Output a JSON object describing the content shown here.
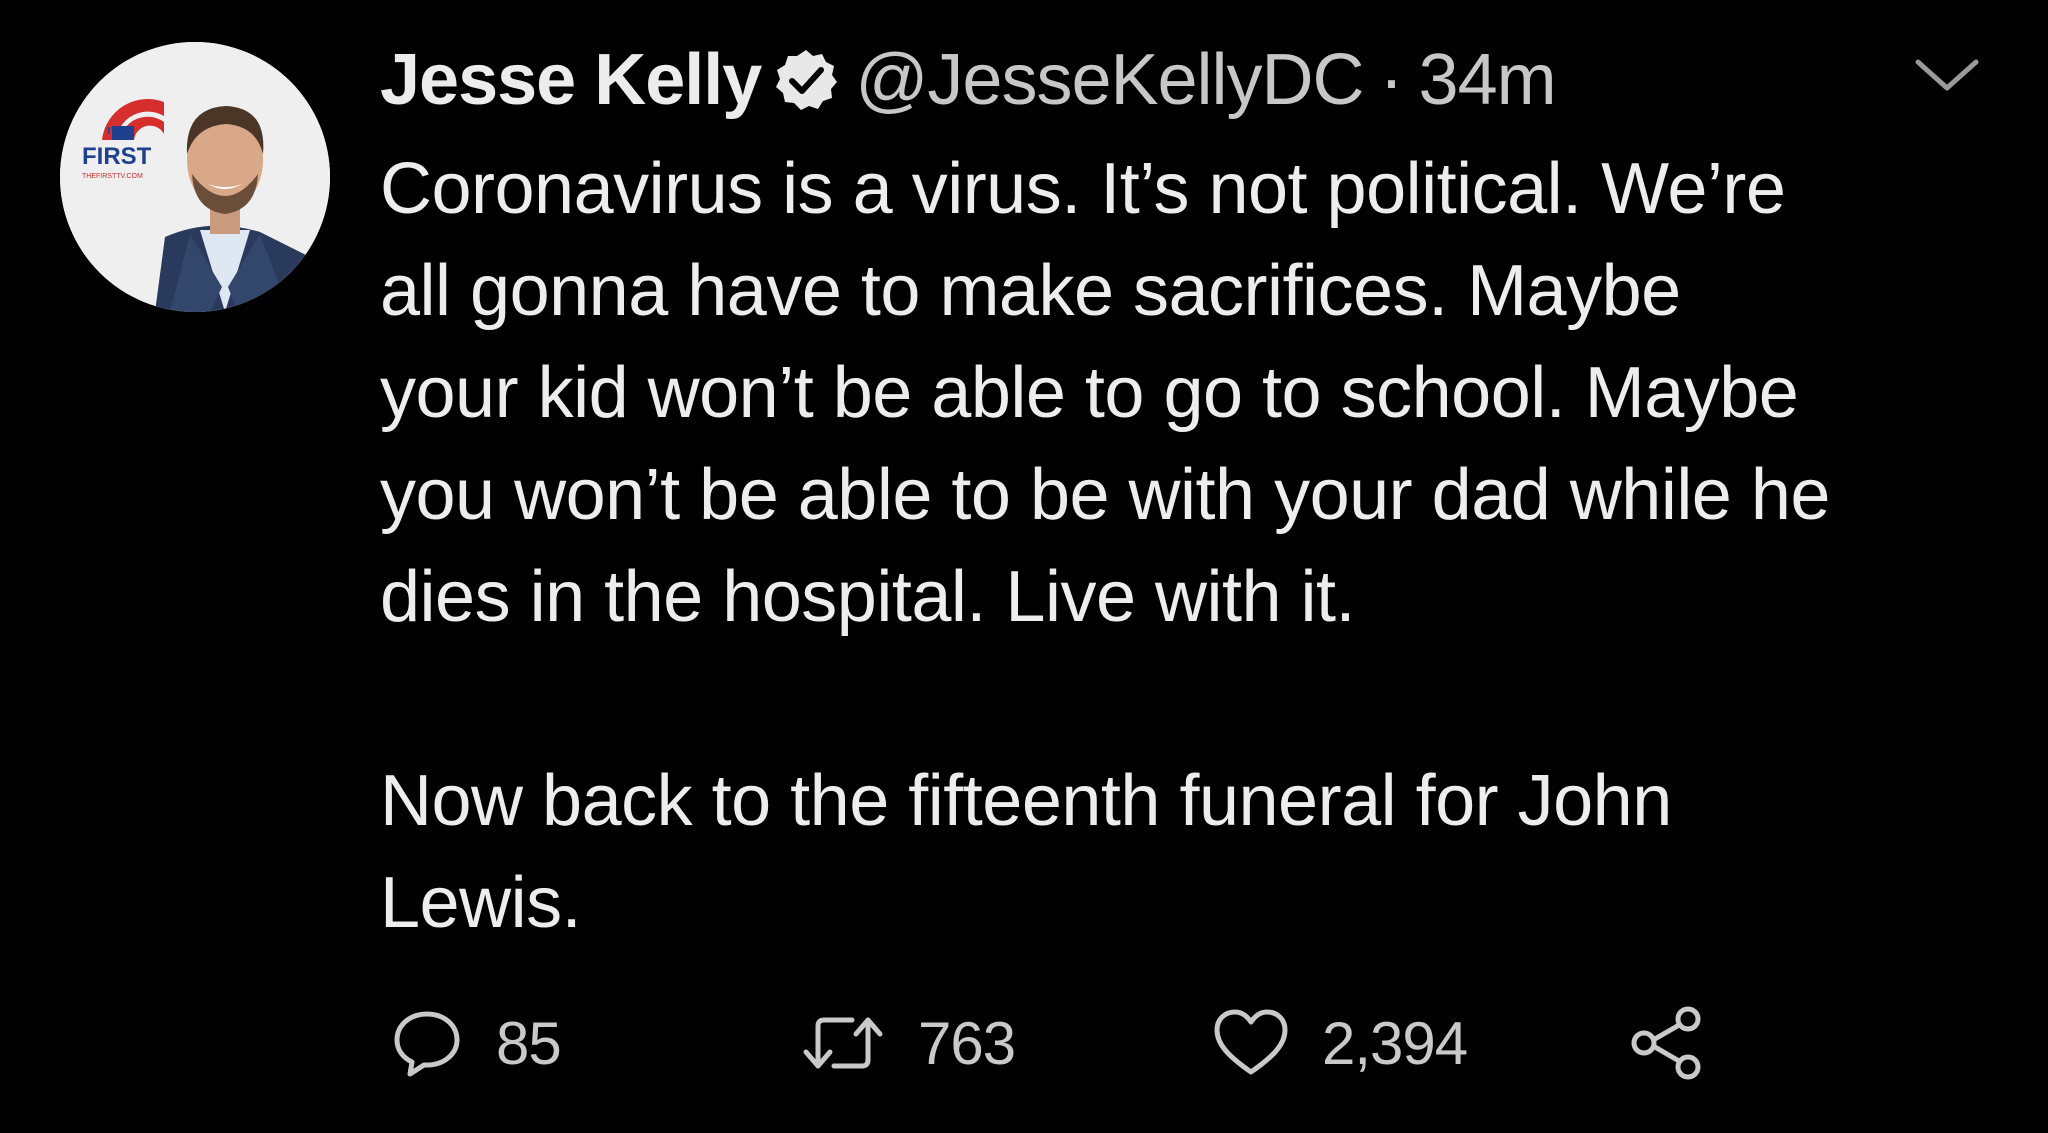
{
  "author": {
    "display_name": "Jesse Kelly",
    "handle": "@JesseKellyDC",
    "separator": "·",
    "timestamp": "34m",
    "verified": true,
    "avatar_badge": {
      "small_text": "THE",
      "brand_text": "FIRST",
      "url_text": "THEFIRSTTV.COM"
    }
  },
  "tweet": {
    "paragraphs": [
      "Coronavirus is a virus. It’s not political. We’re\nall gonna have to make sacrifices. Maybe\nyour kid won’t be able to go to school. Maybe\nyou won’t be able to be with your dad while he\ndies in the hospital. Live with it.",
      "Now back to the fifteenth funeral for John\nLewis."
    ]
  },
  "actions": {
    "reply_count": "85",
    "retweet_count": "763",
    "like_count": "2,394"
  },
  "icons": {
    "reply": "reply-icon",
    "retweet": "retweet-icon",
    "like": "heart-icon",
    "share": "share-icon",
    "more": "chevron-down-icon",
    "verified": "verified-badge-icon"
  },
  "colors": {
    "background": "#000000",
    "text_primary": "#ededed",
    "text_secondary": "#c7c7c7",
    "badge_red": "#d62d2d",
    "badge_blue": "#1f3f8f"
  }
}
